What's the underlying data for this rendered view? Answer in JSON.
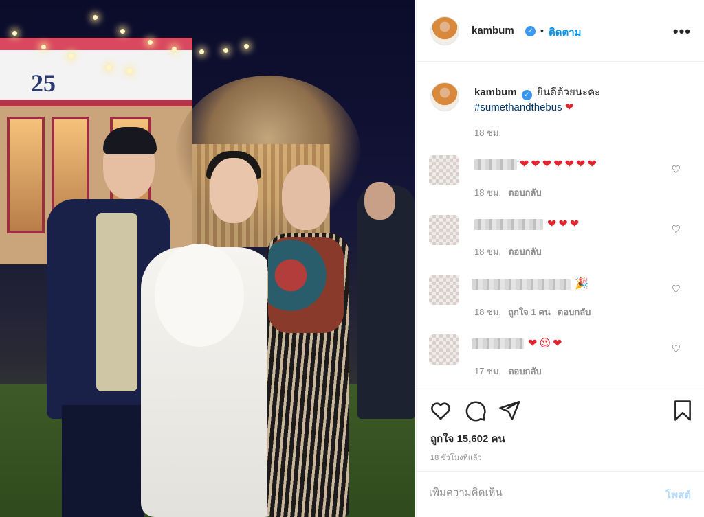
{
  "post": {
    "image_alt": "Photo",
    "bus_number": "25"
  },
  "header": {
    "username": "kambum",
    "verified_badge": "verified-badge-icon",
    "separator": "•",
    "follow_label": "ติดตาม",
    "more_label": "•••"
  },
  "caption": {
    "username": "kambum",
    "text": "ยินดีด้วยนะคะ",
    "hashtag": "#sumethandthebus",
    "emoji": "❤",
    "time": "18 ชม."
  },
  "comments": [
    {
      "emojis": "❤❤❤❤❤❤❤",
      "time": "18 ชม.",
      "likes": "",
      "reply": "ตอบกลับ"
    },
    {
      "emojis": "❤❤❤",
      "time": "18 ชม.",
      "likes": "",
      "reply": "ตอบกลับ"
    },
    {
      "emojis": "🎉",
      "time": "18 ชม.",
      "likes": "ถูกใจ 1 คน",
      "reply": "ตอบกลับ"
    },
    {
      "emojis": "❤😍❤",
      "time": "17 ชม.",
      "likes": "",
      "reply": "ตอบกลับ"
    }
  ],
  "actions": {
    "likes_text": "ถูกใจ 15,602 คน",
    "time_ago": "18 ชั่วโมงที่แล้ว"
  },
  "comment_box": {
    "placeholder": "เพิ่มความคิดเห็น",
    "post_label": "โพสต์"
  },
  "colors": {
    "accent": "#0095f6",
    "verified": "#3897f0",
    "heart": "#e0252f"
  }
}
